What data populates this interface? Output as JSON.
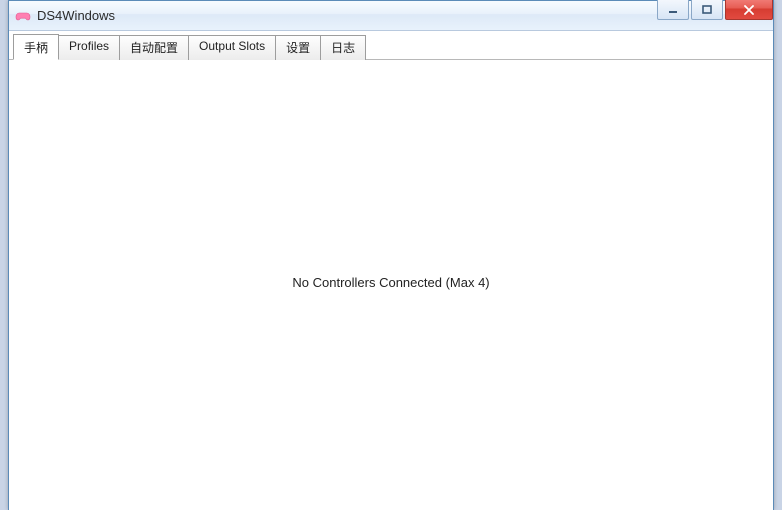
{
  "window": {
    "title": "DS4Windows"
  },
  "tabs": [
    {
      "label": "手柄",
      "active": true
    },
    {
      "label": "Profiles",
      "active": false
    },
    {
      "label": "自动配置",
      "active": false
    },
    {
      "label": "Output Slots",
      "active": false
    },
    {
      "label": "设置",
      "active": false
    },
    {
      "label": "日志",
      "active": false
    }
  ],
  "main": {
    "empty_message": "No Controllers Connected (Max 4)"
  }
}
